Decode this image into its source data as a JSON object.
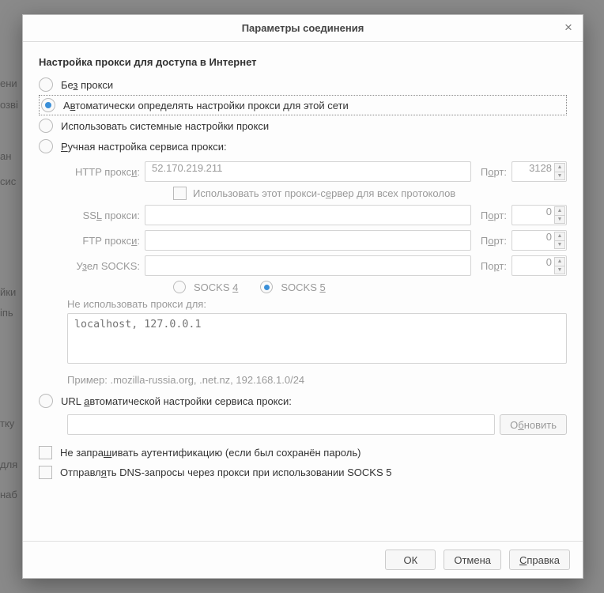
{
  "dialog": {
    "title": "Параметры соединения",
    "section_title": "Настройка прокси для доступа в Интернет"
  },
  "radios": {
    "none": "Без прокси",
    "auto": "Автоматически определять настройки прокси для этой сети",
    "system": "Использовать системные настройки прокси",
    "manual": "Ручная настройка сервиса прокси:",
    "pac": "URL автоматической настройки сервиса прокси:",
    "selected": "auto"
  },
  "proxy": {
    "http_label": "HTTP прокси:",
    "http_value": "52.170.219.211",
    "http_port": "3128",
    "use_for_all": "Использовать этот прокси-сервер для всех протоколов",
    "ssl_label": "SSL прокси:",
    "ssl_value": "",
    "ssl_port": "0",
    "ftp_label": "FTP прокси:",
    "ftp_value": "",
    "ftp_port": "0",
    "socks_label": "Узел SOCKS:",
    "socks_value": "",
    "socks_port": "0",
    "port_label": "Порт:",
    "socks4": "SOCKS 4",
    "socks5": "SOCKS 5",
    "socks_version": "5",
    "noproxy_label": "Не использовать прокси для:",
    "noproxy_placeholder": "localhost, 127.0.0.1",
    "example": "Пример: .mozilla-russia.org, .net.nz, 192.168.1.0/24",
    "reload_btn": "Обновить"
  },
  "checks": {
    "no_auth_prompt": "Не запрашивать аутентификацию (если был сохранён пароль)",
    "dns_socks5": "Отправлять DNS-запросы через прокси при использовании SOCKS 5"
  },
  "buttons": {
    "ok": "ОК",
    "cancel": "Отмена",
    "help": "Справка"
  }
}
